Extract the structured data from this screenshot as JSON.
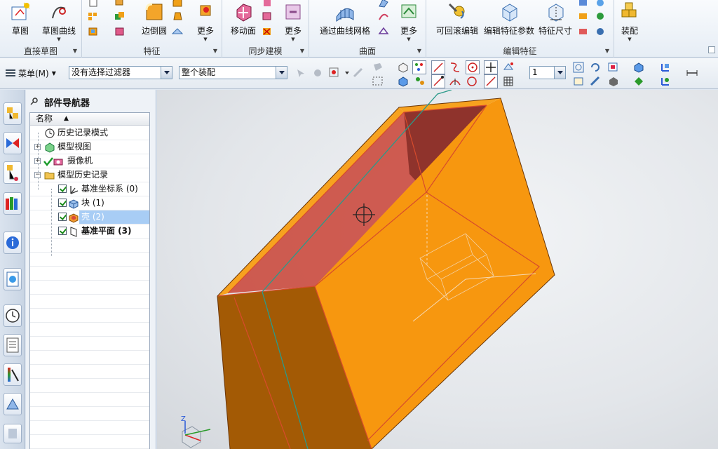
{
  "ribbon": {
    "buttons": {
      "sketch": "草图",
      "sketch_curve": "草图曲线",
      "edge_blend": "边倒圆",
      "more_feature": "更多",
      "move_face": "移动面",
      "more_sync": "更多",
      "through_curve_mesh": "通过曲线网格",
      "more_surface": "更多",
      "rollback_edit": "可回滚编辑",
      "edit_feature_params": "编辑特征参数",
      "feature_dimension": "特征尺寸",
      "assembly": "装配"
    },
    "groups": {
      "direct_sketch": "直接草图",
      "feature": "特征",
      "sync_modeling": "同步建模",
      "surface": "曲面",
      "edit_feature": "编辑特征"
    }
  },
  "toolbar": {
    "menu_label": "菜单(M)",
    "filter_value": "没有选择过滤器",
    "scope_value": "整个装配",
    "layer_value": "1"
  },
  "navigator": {
    "title": "部件导航器",
    "column_name": "名称",
    "items": [
      {
        "label": "历史记录模式"
      },
      {
        "label": "模型视图"
      },
      {
        "label": "摄像机"
      },
      {
        "label": "模型历史记录"
      },
      {
        "label": "基准坐标系 (0)"
      },
      {
        "label": "块 (1)"
      },
      {
        "label": "壳 (2)"
      },
      {
        "label": "基准平面 (3)"
      }
    ]
  },
  "view": {
    "triad_label": "Z"
  },
  "colors": {
    "part_orange": "#f7970f",
    "part_dark": "#a35a05",
    "inner_red": "#c6483a",
    "edge_red": "#d74b2c",
    "selection_blue": "#a8cdf5"
  }
}
